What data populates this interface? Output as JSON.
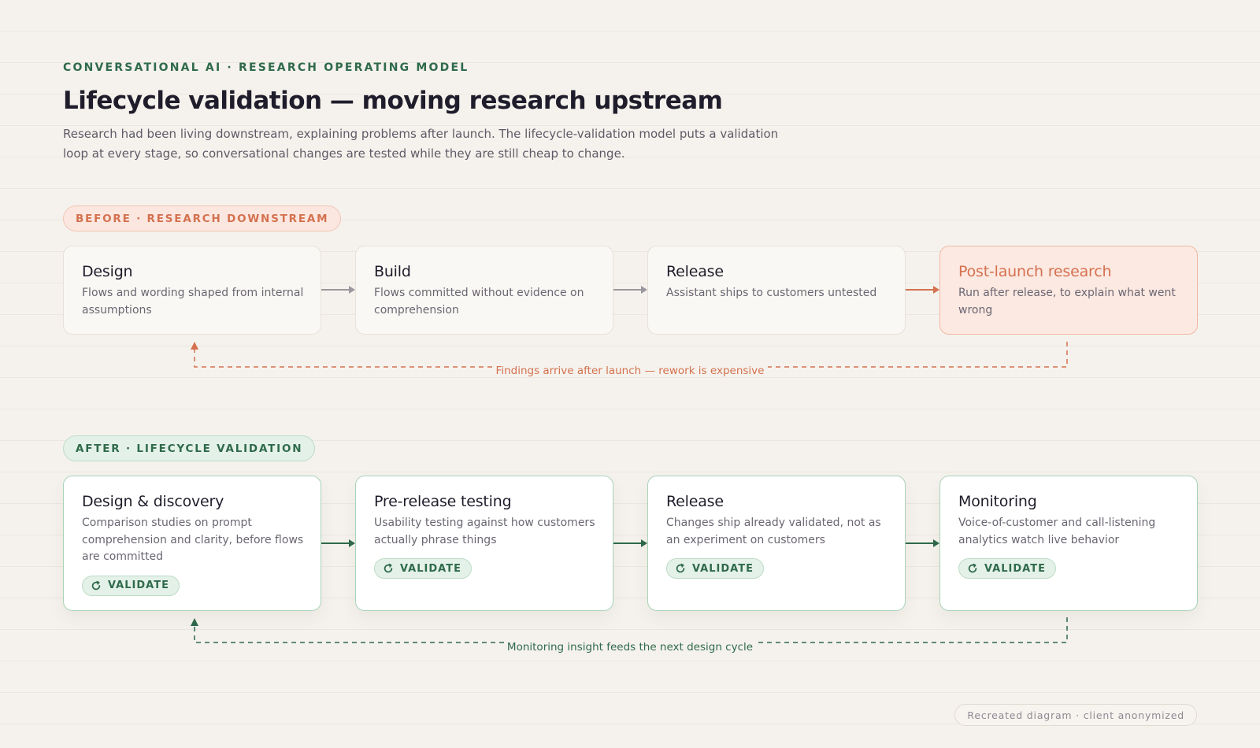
{
  "header": {
    "eyebrow": "CONVERSATIONAL AI · RESEARCH OPERATING MODEL",
    "title": "Lifecycle validation — moving research upstream",
    "lede": "Research had been living downstream, explaining problems after launch. The lifecycle-validation model puts a validation loop at every stage, so conversational changes are tested while they are still cheap to change."
  },
  "before": {
    "label": "BEFORE · RESEARCH DOWNSTREAM",
    "stages": [
      {
        "title": "Design",
        "description": "Flows and wording shaped from internal assumptions"
      },
      {
        "title": "Build",
        "description": "Flows committed without evidence on comprehension"
      },
      {
        "title": "Release",
        "description": "Assistant ships to customers untested"
      },
      {
        "title": "Post-launch research",
        "description": "Run after release, to explain what went wrong"
      }
    ],
    "loop_label": "Findings arrive after launch — rework is expensive"
  },
  "after": {
    "label": "AFTER · LIFECYCLE VALIDATION",
    "stages": [
      {
        "title": "Design & discovery",
        "description": "Comparison studies on prompt comprehension and clarity, before flows are committed",
        "badge": "VALIDATE"
      },
      {
        "title": "Pre-release testing",
        "description": "Usability testing against how customers actually phrase things",
        "badge": "VALIDATE"
      },
      {
        "title": "Release",
        "description": "Changes ship already validated, not as an experiment on customers",
        "badge": "VALIDATE"
      },
      {
        "title": "Monitoring",
        "description": "Voice-of-customer and call-listening analytics watch live behavior",
        "badge": "VALIDATE"
      }
    ],
    "loop_label": "Monitoring insight feeds the next design cycle"
  },
  "footnote": "Recreated diagram · client anonymized",
  "colors": {
    "background": "#f5f2ed",
    "before_accent": "#d4714f",
    "after_accent": "#2f6a4b",
    "neutral_arrow": "#9b979e"
  }
}
